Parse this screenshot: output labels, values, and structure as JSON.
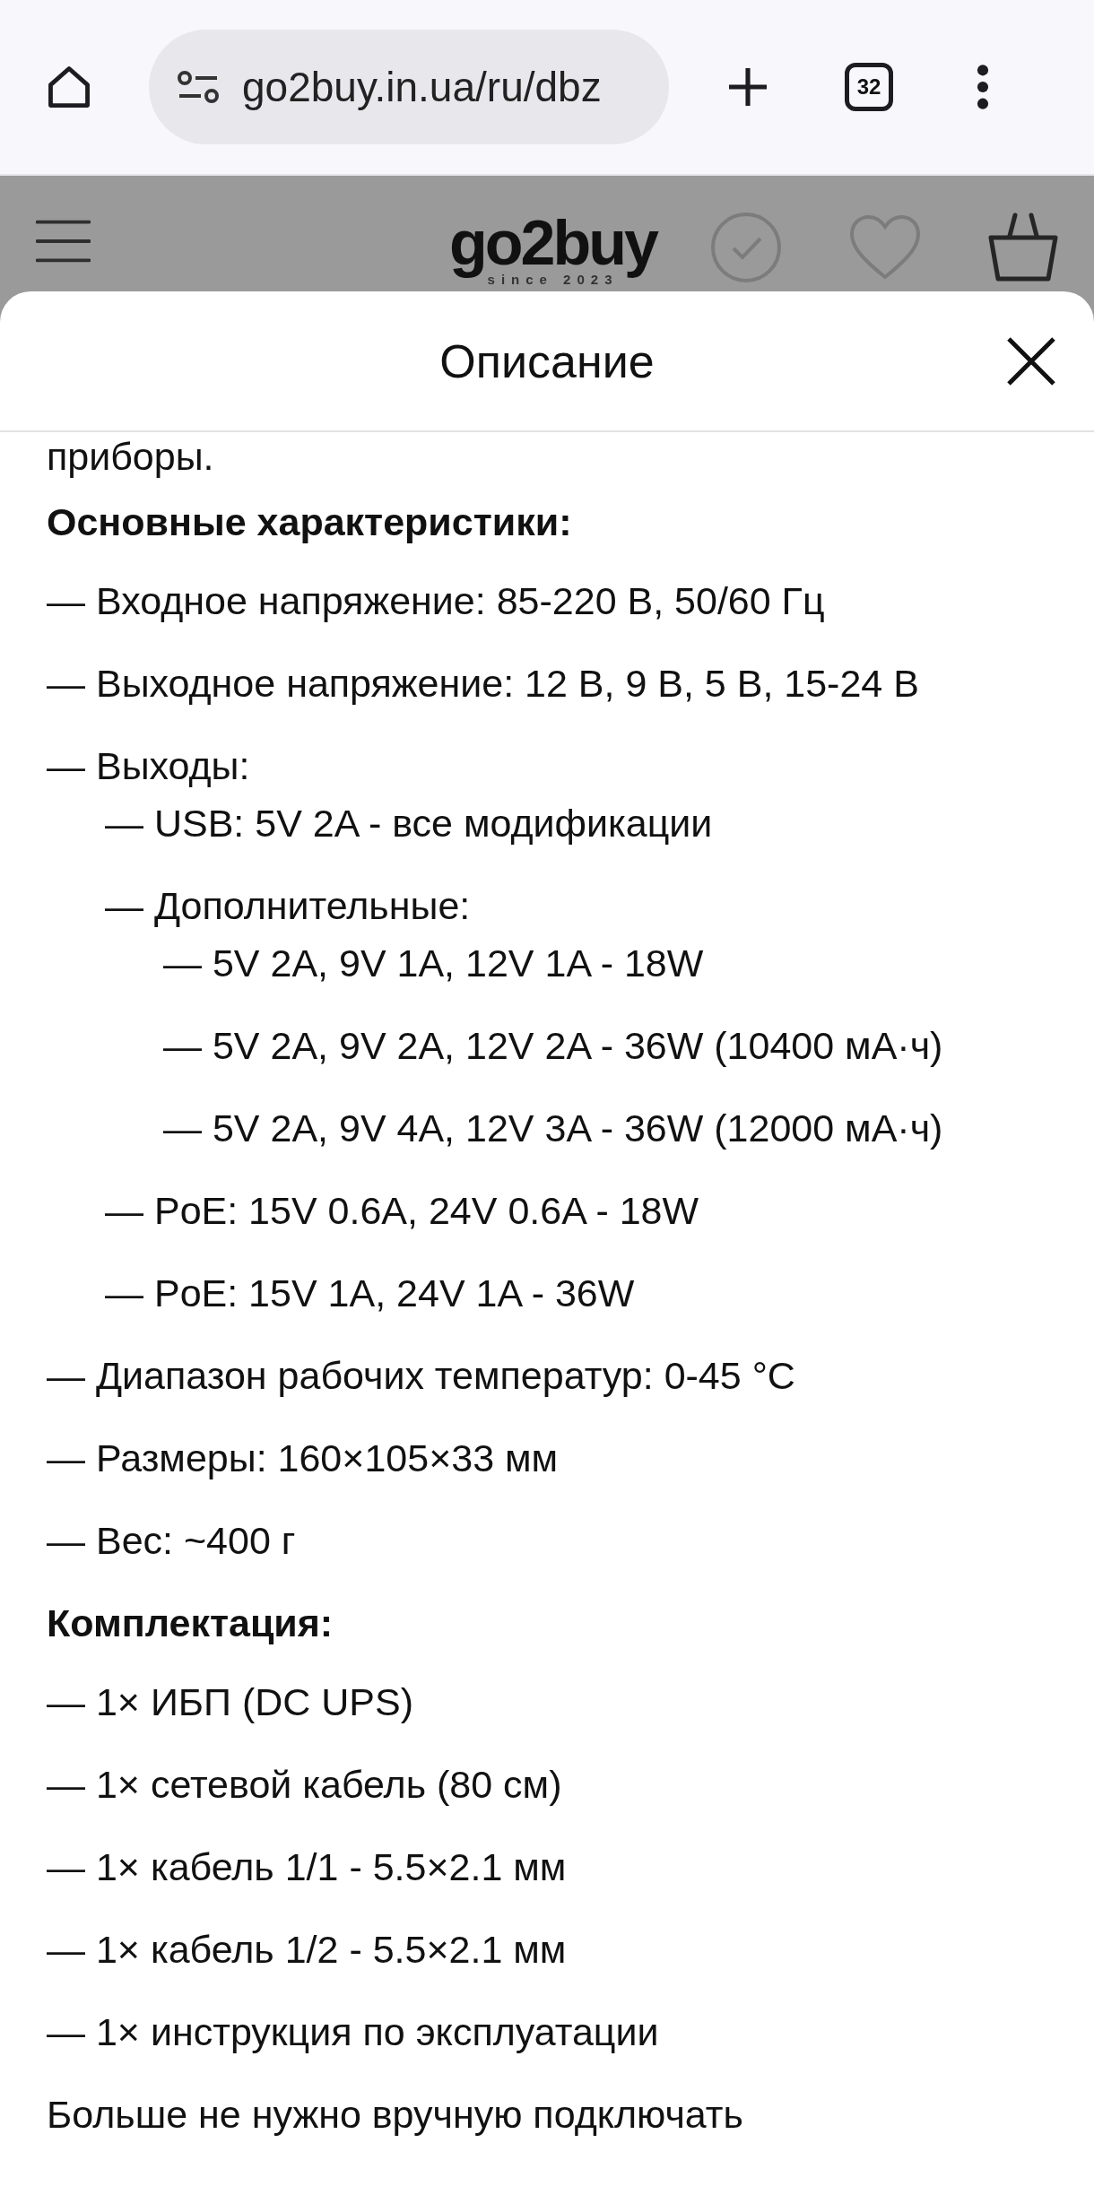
{
  "browser": {
    "url": "go2buy.in.ua/ru/dbz",
    "tab_count": "32"
  },
  "site_header": {
    "logo": "go2buy",
    "logo_tagline": "since 2023"
  },
  "sheet": {
    "title": "Описание",
    "blocks": [
      {
        "kind": "paragraph",
        "text": "приборы."
      },
      {
        "kind": "heading",
        "text": "Основные характеристики:"
      },
      {
        "kind": "item",
        "text": "— Входное напряжение: 85-220 В, 50/60 Гц"
      },
      {
        "kind": "item",
        "text": "— Выходное напряжение: 12 В, 9 В, 5 В, 15-24 В"
      },
      {
        "kind": "item",
        "text": "— Выходы:",
        "children": [
          {
            "text": "— USB: 5V 2A - все модификации"
          },
          {
            "text": "— Дополнительные:",
            "children": [
              {
                "text": "— 5V 2A, 9V 1A, 12V 1A - 18W"
              },
              {
                "text": "— 5V 2A, 9V 2A, 12V 2A - 36W (10400 мА·ч)"
              },
              {
                "text": "— 5V 2A, 9V 4A, 12V 3A - 36W (12000 мА·ч)"
              }
            ]
          },
          {
            "text": "— PoE: 15V 0.6A, 24V 0.6A - 18W"
          },
          {
            "text": "— PoE: 15V 1A, 24V 1A - 36W"
          }
        ]
      },
      {
        "kind": "item",
        "text": "— Диапазон рабочих температур: 0-45 °C"
      },
      {
        "kind": "item",
        "text": "— Размеры: 160×105×33 мм"
      },
      {
        "kind": "item",
        "text": "— Вес: ~400 г"
      },
      {
        "kind": "heading",
        "text": "Комплектация:"
      },
      {
        "kind": "item",
        "text": "— 1× ИБП (DC UPS)"
      },
      {
        "kind": "item",
        "text": "— 1× сетевой кабель (80 см)"
      },
      {
        "kind": "item",
        "text": "— 1× кабель 1/1 - 5.5×2.1 мм"
      },
      {
        "kind": "item",
        "text": "— 1× кабель 1/2 - 5.5×2.1 мм"
      },
      {
        "kind": "item",
        "text": "— 1× инструкция по эксплуатации"
      },
      {
        "kind": "paragraph",
        "text": "Больше не нужно вручную подключать"
      }
    ]
  }
}
